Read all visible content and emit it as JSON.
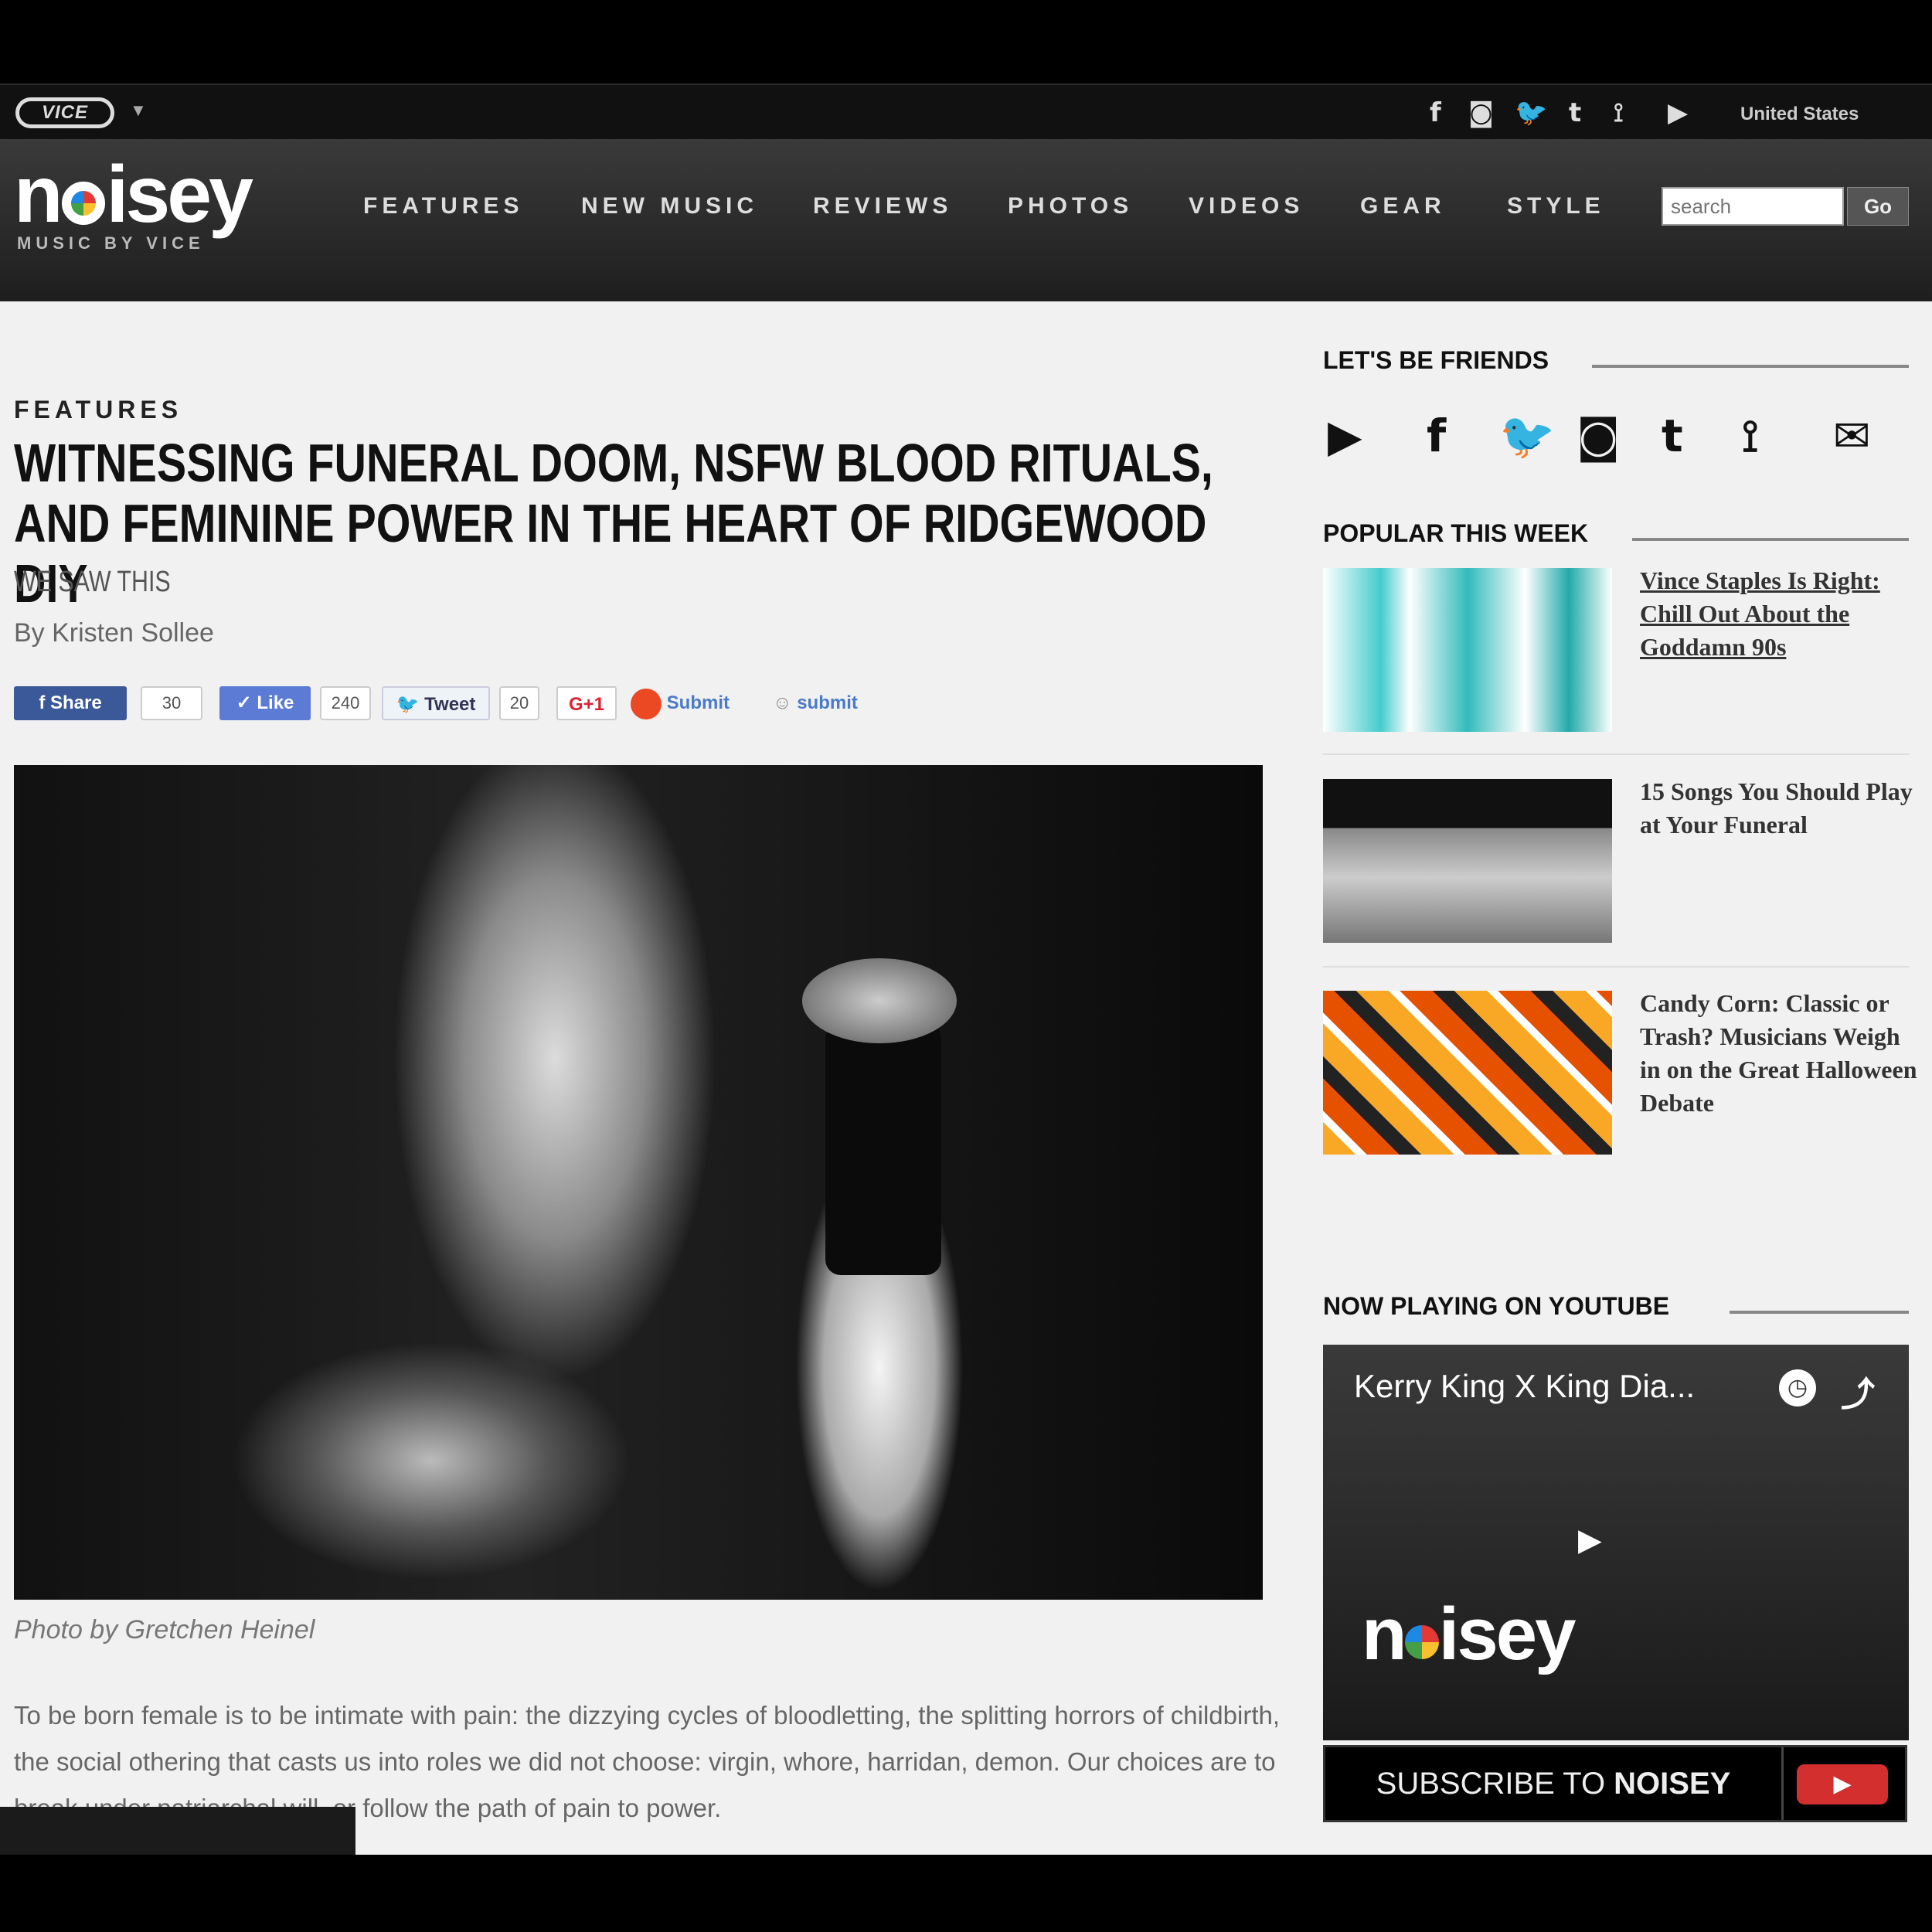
{
  "topbar": {
    "vice_logo": "VICE",
    "caret": "▼",
    "social": [
      "f",
      "◙",
      "🐦",
      "t",
      "⟟",
      "▶"
    ],
    "region": "United States"
  },
  "header": {
    "logo_pre": "n",
    "logo_post": "isey",
    "tagline": "MUSIC BY VICE",
    "nav": [
      "FEATURES",
      "NEW MUSIC",
      "REVIEWS",
      "PHOTOS",
      "VIDEOS",
      "GEAR",
      "STYLE"
    ],
    "search_placeholder": "search",
    "go_label": "Go"
  },
  "article": {
    "section": "FEATURES",
    "headline": "WITNESSING FUNERAL DOOM, NSFW BLOOD RITUALS, AND FEMININE POWER IN THE HEART OF RIDGEWOOD DIY",
    "kicker": "WE SAW THIS",
    "byline": "By Kristen Sollee",
    "share": {
      "facebook_label": "f  Share",
      "facebook_count": "30",
      "like_label": "✓ Like",
      "like_count": "240",
      "tweet_label": "Tweet",
      "tweet_count": "20",
      "gplus_label": "G+1",
      "stumble_label": "Submit",
      "reddit_label": "submit"
    },
    "photo_caption": "Photo by Gretchen Heinel",
    "body": "To be born female is to be intimate with pain: the dizzying cycles of bloodletting, the splitting horrors of childbirth, the social othering that casts us into roles we did not choose: virgin, whore, harridan, demon. Our choices are to break under patriarchal will, or follow the path of pain to power."
  },
  "sidebar": {
    "friends_heading": "LET'S BE FRIENDS",
    "friend_icons": [
      "▶",
      "f",
      "🐦",
      "◙",
      "t",
      "⟟",
      "✉"
    ],
    "popular_heading": "POPULAR THIS WEEK",
    "popular": [
      "Vince Staples Is Right: Chill Out About the Goddamn 90s",
      "15 Songs You Should Play at Your Funeral",
      "Candy Corn: Classic or Trash? Musicians Weigh in on the Great Halloween Debate"
    ],
    "youtube_heading": "NOW PLAYING ON YOUTUBE",
    "video_title": "Kerry King X King Dia...",
    "video_logo_pre": "n",
    "video_logo_post": "isey",
    "subscribe_pre": "SUBSCRIBE TO ",
    "subscribe_brand": "NOISEY",
    "subscribe_icon": "▶"
  }
}
